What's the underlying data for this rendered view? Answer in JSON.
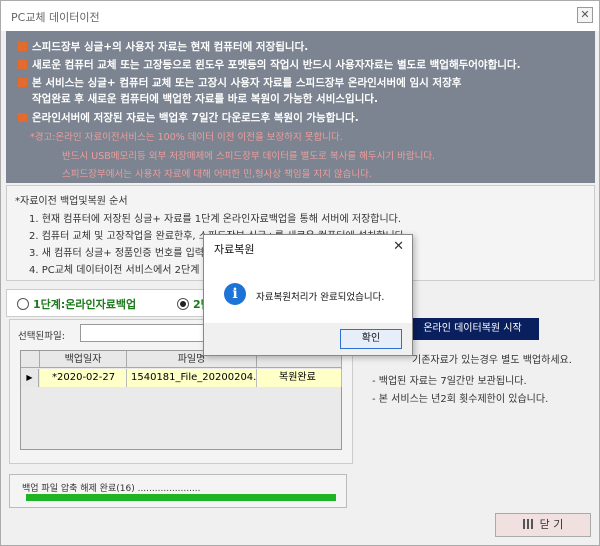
{
  "window": {
    "title": "PC교체 데이터이전",
    "close_glyph": "✕"
  },
  "notice": {
    "lines": [
      "스피드장부 싱글+의 사용자 자료는 현재 컴퓨터에 저장됩니다.",
      "새로운 컴퓨터 교체 또는 고장등으로 윈도우 포멧등의 작업시 반드시 사용자자료는 별도로 백업해두어야합니다.",
      "본 서비스는 싱글+ 컴퓨터 교체 또는 고장시 사용자 자료를 스피드장부 온라인서버에 임시 저장후",
      "작업완료 후 새로운 컴퓨터에 백업한 자료를 바로 복원이 가능한 서비스입니다.",
      "온라인서버에 저장된 자료는 백업후 7일간 다운로드후 복원이 가능합니다."
    ],
    "warnings": [
      "*경고:온라인 자료이전서비스는 100% 데이터 이전 이전을 보장하지 못합니다.",
      "반드시 USB메모리등 외부 저장매체에 스피드장부 데이터를 별도로 복사를 해두시기 바랍니다.",
      "스피드장부에서는 사용자 자료에 대해 어떠한 민,형사상 책임을 지지 않습니다."
    ]
  },
  "steps": {
    "heading": "*자료이전 백업및복원 순서",
    "items": [
      "1. 현재 컴퓨터에 저장된 싱글+ 자료를 1단계 온라인자료백업을 통해 서버에 저장합니다.",
      "2. 컴퓨터 교체 및 고장작업을 완료한후, 스피드장부 싱글+를 새로운 컴퓨터에 설치합니다.",
      "3. 새 컴퓨터 싱글+ 정품인증 번호를 입력",
      "4. PC교체 데이터이전 서비스에서 2단계"
    ]
  },
  "tabs": {
    "step1": "1단계:온라인자료백업",
    "step2": "2단"
  },
  "file_select": {
    "label": "선택된파일:"
  },
  "grid": {
    "headers": [
      "백업일자",
      "파일명",
      ""
    ],
    "row": {
      "date": "*2020-02-27",
      "file": "1540181_File_20200204.dat",
      "status": "복원완료"
    },
    "row_marker": "▶"
  },
  "restore_button": "온라인 데이터복원 시작",
  "notes": [
    "기존자료가 있는경우 별도 백업하세요.",
    "- 백업된 자료는 7일간만 보관됩니다.",
    "- 본 서비스는 년2회 횟수제한이 있습니다."
  ],
  "progress": {
    "text": "백업 파일 압축 해제 완료(16) ......................",
    "fraction": 1.0,
    "color": "#1fb325"
  },
  "close_button": "닫 기",
  "dialog": {
    "title": "자료복원",
    "close_glyph": "✕",
    "icon": "info-icon",
    "icon_glyph": "i",
    "message": "자료복원처리가 완료되었습니다.",
    "ok_label": "확인"
  }
}
